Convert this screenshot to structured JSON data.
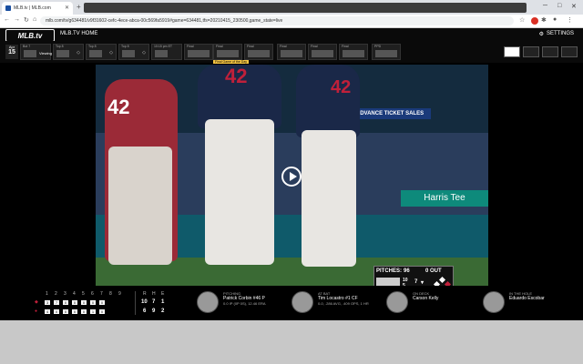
{
  "browser": {
    "tab_title": "MLB.tv | MLB.com",
    "url": "mlb.com/tv/g634481/v9f31602-cefc-4ece-abca-00c569fa5919#game=634481,tfs=20210415_230500,game_state=live"
  },
  "app": {
    "logo": "MLB.tv",
    "home_label": "MLB.TV HOME",
    "settings_label": "SETTINGS",
    "date": {
      "month": "Apr",
      "day": "15"
    },
    "games": [
      {
        "label": "Bot 7",
        "viewing": "Viewing"
      },
      {
        "label": "Top 8"
      },
      {
        "label": "Top 8"
      },
      {
        "label": "Top 8"
      },
      {
        "label": "10:15 pm ET"
      },
      {
        "label": "Final"
      },
      {
        "label": "Final"
      },
      {
        "label": "Final"
      },
      {
        "label": "Final"
      },
      {
        "label": "Final"
      },
      {
        "label": "Final"
      },
      {
        "label": "PPD"
      }
    ],
    "tooltip": "Final Game of the Day"
  },
  "video": {
    "banner_ad": "ADVANCE TICKET SALES",
    "banner_harris": "Harris Tee",
    "jerseys": {
      "left": "42",
      "center": "42",
      "right": "42"
    },
    "scorebug": {
      "pitches_label": "PITCHES:",
      "pitches": "96",
      "outs": "0 OUT",
      "top_score": "10",
      "bot_score": "5",
      "inning": "7"
    }
  },
  "linescore": {
    "innings": [
      "1",
      "2",
      "3",
      "4",
      "5",
      "6",
      "7",
      "8",
      "9"
    ],
    "away": [
      "3",
      "7",
      "0",
      "0",
      "0",
      "0",
      "0",
      "",
      ""
    ],
    "home": [
      "4",
      "0",
      "0",
      "0",
      "0",
      "1",
      "0",
      "",
      ""
    ],
    "rhe_headers": [
      "R",
      "H",
      "E"
    ],
    "away_rhe": [
      "10",
      "7",
      "1"
    ],
    "home_rhe": [
      "6",
      "9",
      "2"
    ]
  },
  "players": {
    "pitching": {
      "role": "PITCHING",
      "name": "Patrick Corbin",
      "num": "#46 P",
      "stat": "0.0 IP (0P 0S), 12.46 ERA"
    },
    "at_bat": {
      "role": "AT BAT",
      "name": "Tim Locastro",
      "num": "#1 CF",
      "stat": "0-0, .286 AVG, .409 OPS, 1 HR"
    },
    "on_deck": {
      "role": "ON DECK",
      "name": "Carson Kelly"
    },
    "in_hole": {
      "role": "IN THE HOLE",
      "name": "Eduardo Escobar"
    }
  }
}
